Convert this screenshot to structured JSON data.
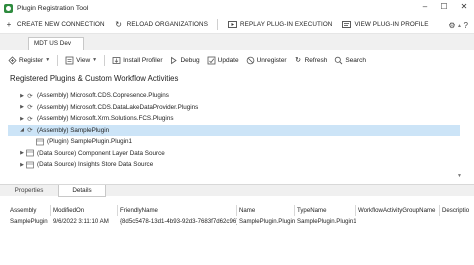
{
  "window": {
    "title": "Plugin Registration Tool",
    "controls": [
      "–",
      "☐",
      "✕"
    ]
  },
  "commandbar": {
    "items": [
      {
        "label": "CREATE NEW CONNECTION",
        "icon": "plus-icon"
      },
      {
        "label": "RELOAD ORGANIZATIONS",
        "icon": "refresh-icon"
      },
      {
        "label": "REPLAY PLUG-IN EXECUTION",
        "icon": "replay-icon"
      },
      {
        "label": "VIEW PLUG-IN PROFILE",
        "icon": "view-profile-icon"
      }
    ],
    "right_icons": [
      "gear-icon",
      "help-icon"
    ]
  },
  "doc_tab": {
    "label": "MDT US Dev"
  },
  "toolbar": {
    "items": [
      {
        "label": "Register",
        "icon": "register-icon",
        "dropdown": true
      },
      {
        "label": "View",
        "icon": "view-icon",
        "dropdown": true
      },
      {
        "label": "Install Profiler",
        "icon": "install-profiler-icon"
      },
      {
        "label": "Debug",
        "icon": "debug-icon"
      },
      {
        "label": "Update",
        "icon": "update-icon"
      },
      {
        "label": "Unregister",
        "icon": "unregister-icon"
      },
      {
        "label": "Refresh",
        "icon": "refresh-icon"
      },
      {
        "label": "Search",
        "icon": "search-icon"
      }
    ]
  },
  "main": {
    "title": "Registered Plugins & Custom Workflow Activities",
    "tree": [
      {
        "label": "(Assembly) Microsoft.CDS.Copresence.Plugins",
        "expander": "▶",
        "level": 0
      },
      {
        "label": "(Assembly) Microsoft.CDS.DataLakeDataProvider.Plugins",
        "expander": "▶",
        "level": 0
      },
      {
        "label": "(Assembly) Microsoft.Xrm.Solutions.FCS.Plugins",
        "expander": "▶",
        "level": 0
      },
      {
        "label": "(Assembly) SamplePlugin",
        "expander": "◢",
        "level": 0,
        "selected": true
      },
      {
        "label": "(Plugin) SamplePlugin.Plugin1",
        "expander": "",
        "level": 1
      },
      {
        "label": "(Data Source) Component Layer Data Source",
        "expander": "▶",
        "level": 0
      },
      {
        "label": "(Data Source) Insights Store Data Source",
        "expander": "▶",
        "level": 0
      }
    ]
  },
  "panel": {
    "tabs": [
      {
        "label": "Properties",
        "active": false
      },
      {
        "label": "Details",
        "active": true
      }
    ],
    "grid": {
      "columns": [
        "Assembly",
        "ModifiedOn",
        "FriendlyName",
        "Name",
        "TypeName",
        "WorkflowActivityGroupName",
        "Descriptio"
      ],
      "rows": [
        [
          "SamplePlugin",
          "9/6/2022 3:11:10 AM",
          "{8d5c5478-13d1-4b93-92d3-7683f7d62c96}",
          "SamplePlugin.Plugin1",
          "SamplePlugin.Plugin1",
          "",
          ""
        ]
      ]
    }
  }
}
